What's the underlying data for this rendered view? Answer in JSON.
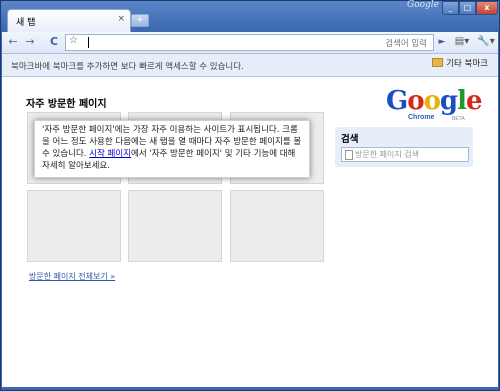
{
  "window": {
    "title_brand": "Google",
    "min_label": "_",
    "max_label": "□",
    "close_label": "x"
  },
  "tab": {
    "title": "새 탭",
    "close_glyph": "×",
    "new_tab_glyph": "+"
  },
  "toolbar": {
    "back_glyph": "←",
    "forward_glyph": "→",
    "reload_glyph": "C",
    "star_glyph": "☆",
    "omnibox_hint": "검색어 입력",
    "go_glyph": "►",
    "page_menu_glyph": "▤▾",
    "wrench_glyph": "🔧▾"
  },
  "bookmarks_bar": {
    "hint": "북마크바에 북마크를 추가하면 보다 빠르게 액세스할 수 있습니다.",
    "other_bookmarks": "기타 북마크"
  },
  "content": {
    "most_visited_title": "자주 방문한 페이지",
    "info_text_1": "'자주 방문한 페이지'에는 가장 자주 이용하는 사이트가 표시됩니다. 크롬을 어느 정도 사용한 다음에는 새 탭을 열 때마다 자주 방문한 페이지를 볼 수 있습니다. ",
    "info_link": "시작 페이지",
    "info_text_2": "에서 '자주 방문한 페이지' 및 기타 기능에 대해 자세히 알아보세요.",
    "view_all": "방문한 페이지 전체보기 »",
    "logo_letters": [
      "G",
      "o",
      "o",
      "g",
      "l",
      "e"
    ],
    "logo_colors": [
      "#1a4fc4",
      "#d42a1d",
      "#e8b109",
      "#1a4fc4",
      "#1f9a2b",
      "#d42a1d"
    ],
    "logo_chrome": "Chrome",
    "logo_beta": "BETA",
    "search_title": "검색",
    "search_placeholder": "방문한 페이지 검색"
  }
}
